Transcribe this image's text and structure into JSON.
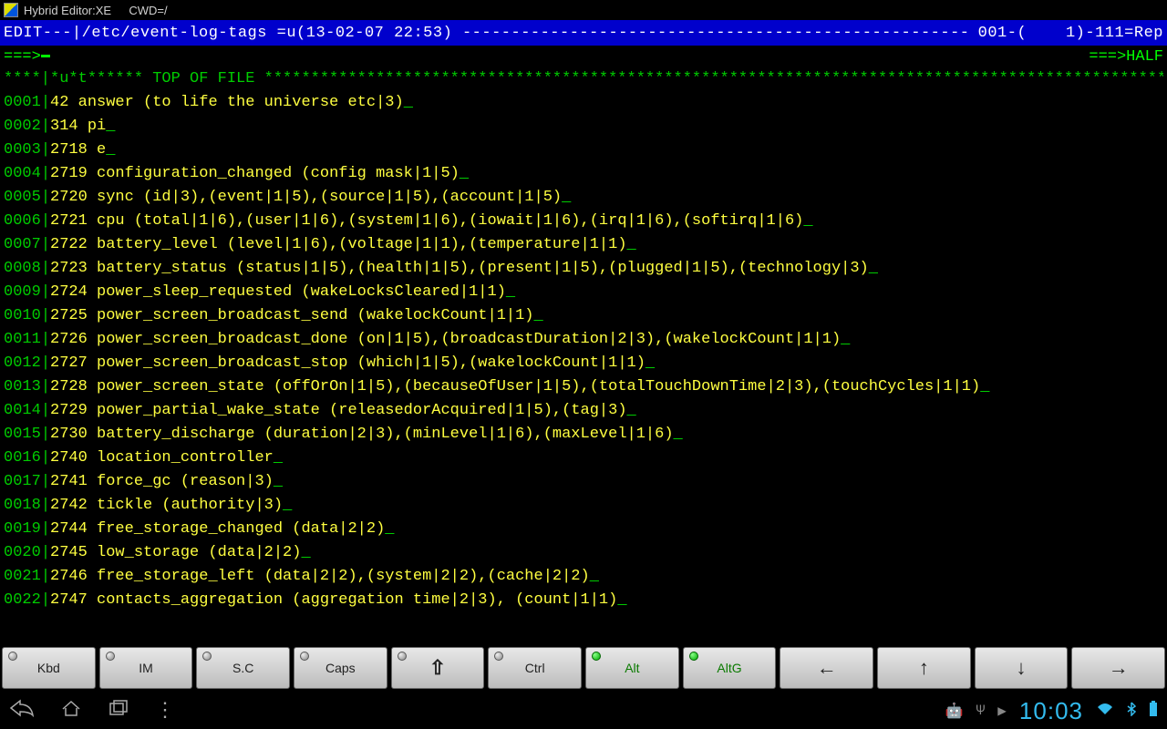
{
  "titlebar": {
    "app": "Hybrid Editor:XE",
    "cwd": "CWD=/"
  },
  "status": {
    "left": "EDIT---|/etc/event-log-tags =u(13-02-07 22:53) ",
    "dashfill": "-------------------------------------------------------------",
    "right": " 001-(    1)-111=Rep"
  },
  "cmd": {
    "left": "===>",
    "right": "===>HALF"
  },
  "topline": "****|*u*t****** TOP OF FILE ****************************************************************************************************************",
  "lines": [
    {
      "n": "0001",
      "t": "42 answer (to life the universe etc|3)"
    },
    {
      "n": "0002",
      "t": "314 pi"
    },
    {
      "n": "0003",
      "t": "2718 e"
    },
    {
      "n": "0004",
      "t": "2719 configuration_changed (config mask|1|5)"
    },
    {
      "n": "0005",
      "t": "2720 sync (id|3),(event|1|5),(source|1|5),(account|1|5)"
    },
    {
      "n": "0006",
      "t": "2721 cpu (total|1|6),(user|1|6),(system|1|6),(iowait|1|6),(irq|1|6),(softirq|1|6)"
    },
    {
      "n": "0007",
      "t": "2722 battery_level (level|1|6),(voltage|1|1),(temperature|1|1)"
    },
    {
      "n": "0008",
      "t": "2723 battery_status (status|1|5),(health|1|5),(present|1|5),(plugged|1|5),(technology|3)"
    },
    {
      "n": "0009",
      "t": "2724 power_sleep_requested (wakeLocksCleared|1|1)"
    },
    {
      "n": "0010",
      "t": "2725 power_screen_broadcast_send (wakelockCount|1|1)"
    },
    {
      "n": "0011",
      "t": "2726 power_screen_broadcast_done (on|1|5),(broadcastDuration|2|3),(wakelockCount|1|1)"
    },
    {
      "n": "0012",
      "t": "2727 power_screen_broadcast_stop (which|1|5),(wakelockCount|1|1)"
    },
    {
      "n": "0013",
      "t": "2728 power_screen_state (offOrOn|1|5),(becauseOfUser|1|5),(totalTouchDownTime|2|3),(touchCycles|1|1)"
    },
    {
      "n": "0014",
      "t": "2729 power_partial_wake_state (releasedorAcquired|1|5),(tag|3)"
    },
    {
      "n": "0015",
      "t": "2730 battery_discharge (duration|2|3),(minLevel|1|6),(maxLevel|1|6)"
    },
    {
      "n": "0016",
      "t": "2740 location_controller"
    },
    {
      "n": "0017",
      "t": "2741 force_gc (reason|3)"
    },
    {
      "n": "0018",
      "t": "2742 tickle (authority|3)"
    },
    {
      "n": "0019",
      "t": "2744 free_storage_changed (data|2|2)"
    },
    {
      "n": "0020",
      "t": "2745 low_storage (data|2|2)"
    },
    {
      "n": "0021",
      "t": "2746 free_storage_left (data|2|2),(system|2|2),(cache|2|2)"
    },
    {
      "n": "0022",
      "t": "2747 contacts_aggregation (aggregation time|2|3), (count|1|1)"
    }
  ],
  "toolbar": {
    "kbd": "Kbd",
    "im": "IM",
    "sc": "S.C",
    "caps": "Caps",
    "shift": "⇧",
    "ctrl": "Ctrl",
    "alt": "Alt",
    "altg": "AltG",
    "left": "←",
    "up": "↑",
    "down": "↓",
    "right": "→"
  },
  "clock": "10:03"
}
